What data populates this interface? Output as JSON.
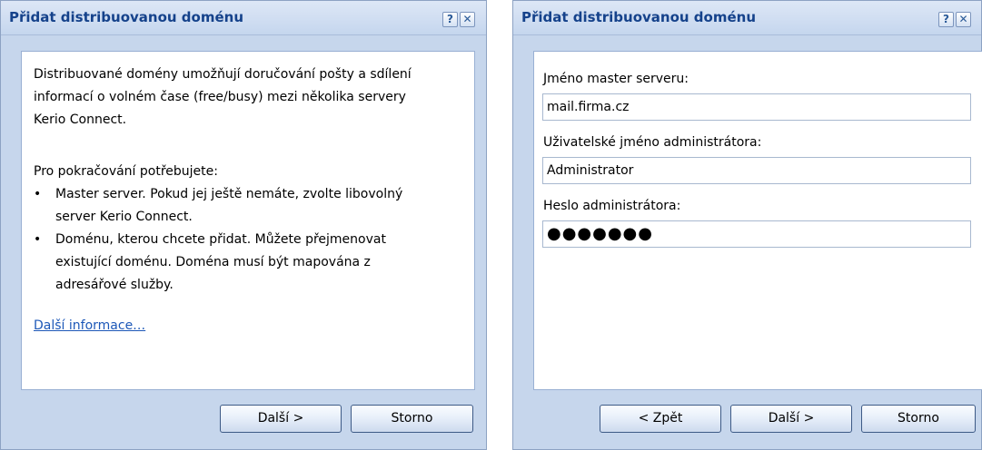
{
  "dialogs": [
    {
      "title": "Přidat distribuovanou doménu",
      "help_label": "?",
      "close_label": "✕",
      "intro": [
        "Distribuované domény umožňují doručování pošty a sdílení",
        "informací o volném čase (free/busy) mezi několika servery",
        "Kerio Connect."
      ],
      "need_heading": "Pro pokračování potřebujete:",
      "bullet_marker": "•",
      "bullet1": [
        "Master server. Pokud jej ještě nemáte, zvolte libovolný",
        "server Kerio Connect."
      ],
      "bullet2": [
        "Doménu, kterou chcete přidat. Můžete přejmenovat",
        "existující doménu. Doména musí být mapována z",
        "adresářové služby."
      ],
      "more_link": "Další informace…",
      "buttons": {
        "next": "Další >",
        "cancel": "Storno"
      }
    },
    {
      "title": "Přidat distribuovanou doménu",
      "help_label": "?",
      "close_label": "✕",
      "master_label": "Jméno master serveru:",
      "master_value": "mail.firma.cz",
      "admin_label": "Uživatelské jméno administrátora:",
      "admin_value": "Administrator",
      "password_label": "Heslo administrátora:",
      "password_display": "●●●●●●●",
      "buttons": {
        "back": "< Zpět",
        "next": "Další >",
        "cancel": "Storno"
      }
    }
  ]
}
